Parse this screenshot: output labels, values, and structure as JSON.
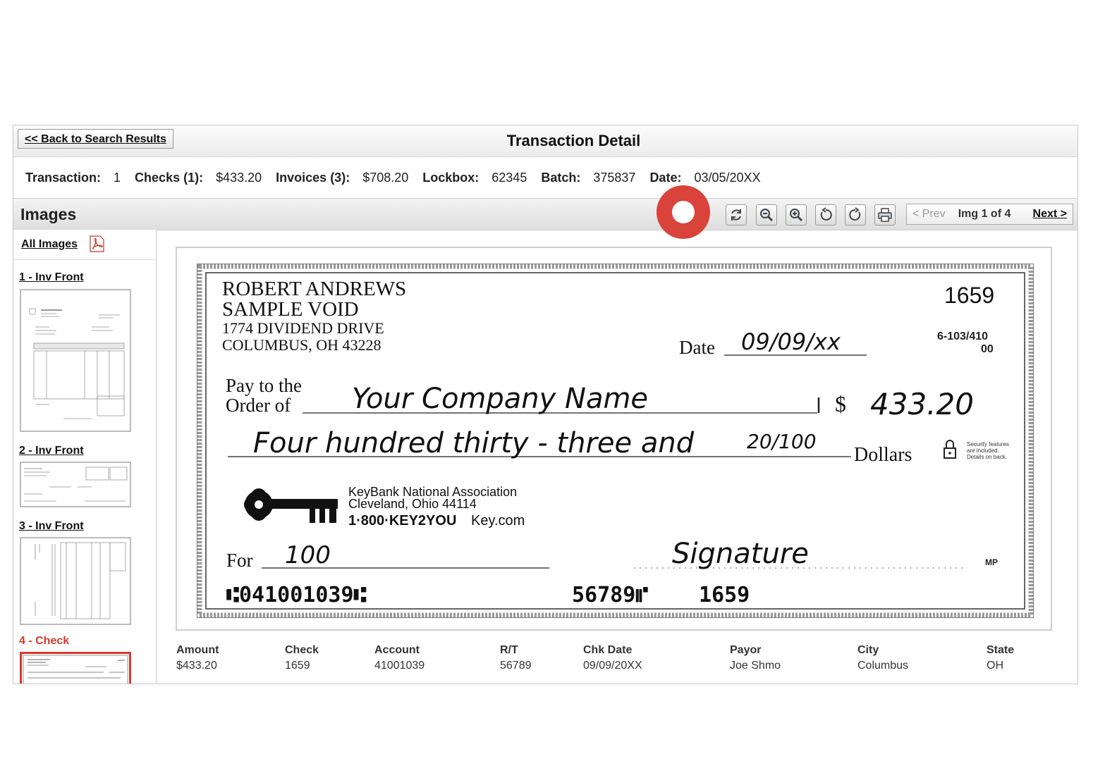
{
  "header": {
    "back_label": "<< Back to Search Results",
    "title": "Transaction Detail"
  },
  "summary": {
    "transaction_label": "Transaction:",
    "transaction_value": "1",
    "checks_label": "Checks (1):",
    "checks_value": "$433.20",
    "invoices_label": "Invoices (3):",
    "invoices_value": "$708.20",
    "lockbox_label": "Lockbox:",
    "lockbox_value": "62345",
    "batch_label": "Batch:",
    "batch_value": "375837",
    "date_label": "Date:",
    "date_value": "03/05/20XX"
  },
  "images_bar": {
    "title": "Images",
    "tools": [
      "refresh-icon",
      "zoom-out-icon",
      "zoom-in-icon",
      "rotate-left-icon",
      "rotate-right-icon",
      "print-icon"
    ],
    "pager": {
      "prev": "< Prev",
      "count": "Img 1 of 4",
      "next": "Next >"
    }
  },
  "sidebar": {
    "all_images": "All Images",
    "items": [
      {
        "label": "1 - Inv Front"
      },
      {
        "label": "2 - Inv Front"
      },
      {
        "label": "3 - Inv Front"
      },
      {
        "label": "4 - Check"
      }
    ]
  },
  "check": {
    "name1": "ROBERT ANDREWS",
    "name2": "SAMPLE VOID",
    "address1": "1774 DIVIDEND DRIVE",
    "address2": "COLUMBUS, OH  43228",
    "number": "1659",
    "date_label": "Date",
    "date_value": "09/09/xx",
    "routing_frac1": "6-103/410",
    "routing_frac2": "00",
    "pay_label1": "Pay to the",
    "pay_label2": "Order of",
    "payee": "Your Company Name",
    "dollar_sign": "$",
    "amount": "433.20",
    "amount_words": "Four hundred thirty - three and",
    "cents": "20/100",
    "dollars_label": "Dollars",
    "security_note": "Security features are included. Details on back.",
    "bank_name": "KeyBank National Association",
    "bank_city": "Cleveland, Ohio 44114",
    "bank_phone": "1·800·KEY2YOU",
    "bank_site": "Key.com",
    "for_label": "For",
    "memo": "100",
    "signature": "Signature",
    "mp": "MP",
    "micr_left": "⑆041001039⑆",
    "micr_mid": "56789⑈",
    "micr_right": "1659"
  },
  "details": [
    {
      "header": "Amount",
      "value": "$433.20"
    },
    {
      "header": "Check",
      "value": "1659"
    },
    {
      "header": "Account",
      "value": "41001039"
    },
    {
      "header": "R/T",
      "value": "56789"
    },
    {
      "header": "Chk Date",
      "value": "09/09/20XX"
    },
    {
      "header": "Payor",
      "value": "Joe Shmo"
    },
    {
      "header": "City",
      "value": "Columbus"
    },
    {
      "header": "State",
      "value": "OH"
    }
  ],
  "colors": {
    "accent_red": "#d8392b",
    "highlight_marker": "#d9433b"
  }
}
